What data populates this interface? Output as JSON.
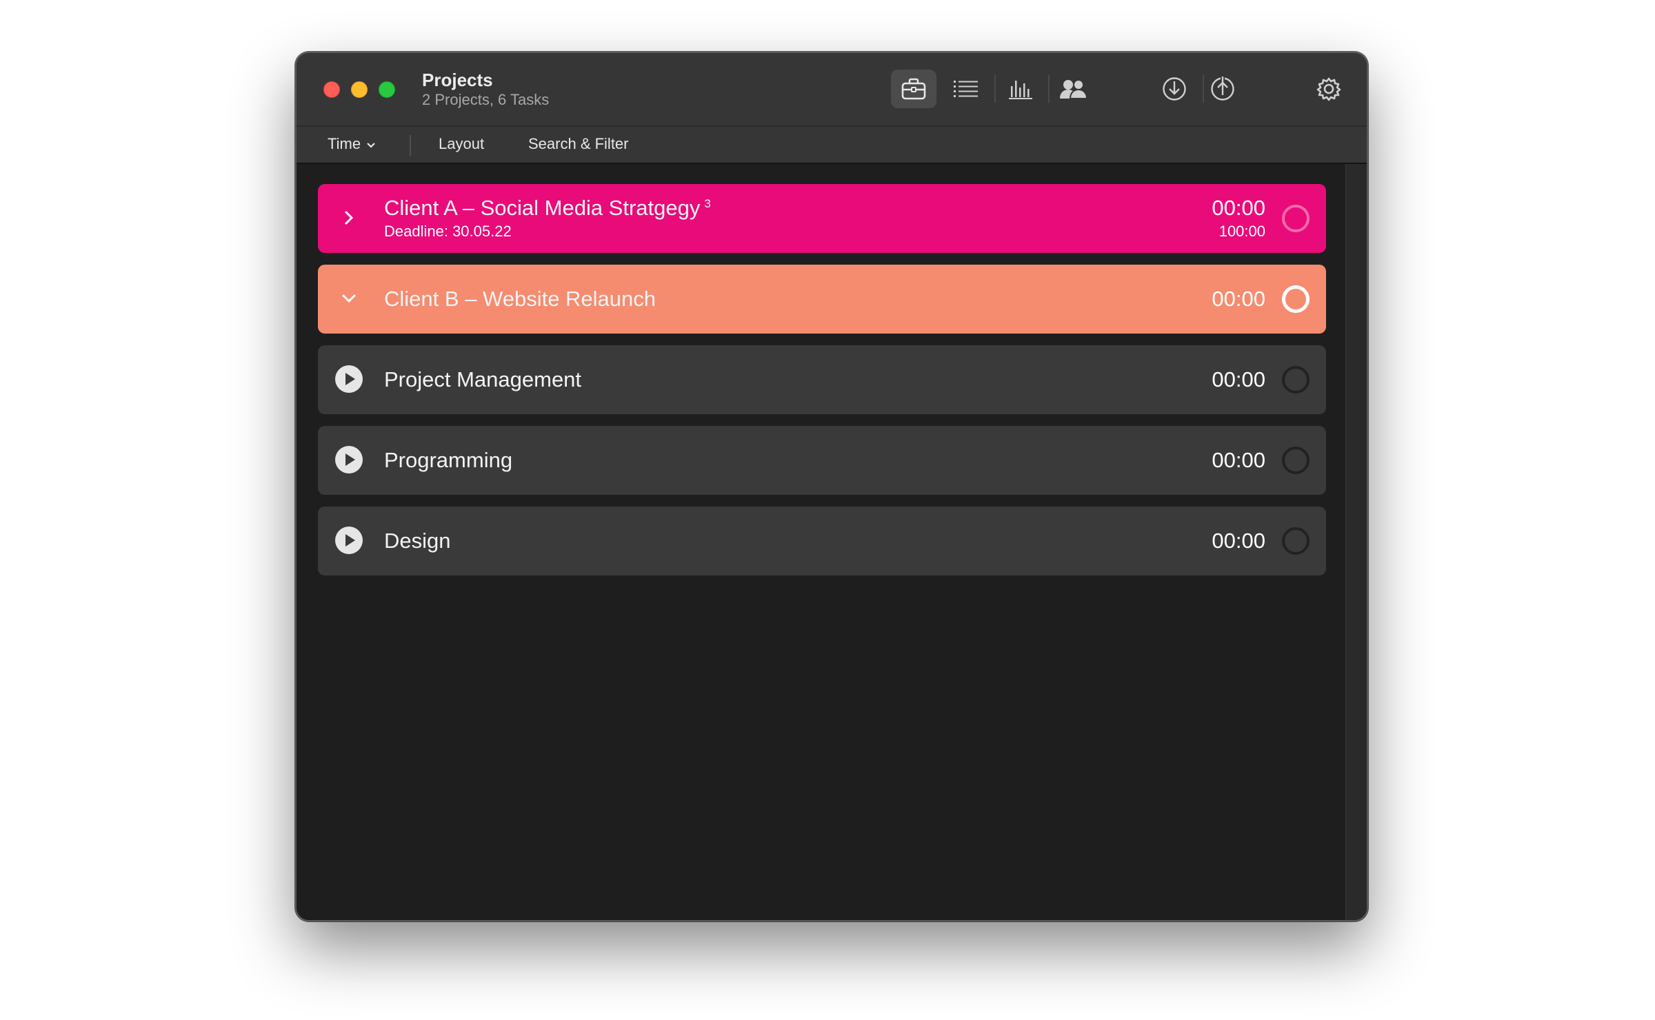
{
  "window": {
    "title": "Projects",
    "subtitle": "2 Projects, 6 Tasks"
  },
  "titlebar_icons": [
    {
      "name": "projects-icon",
      "active": true
    },
    {
      "name": "list-icon",
      "active": false
    },
    {
      "name": "statistics-icon",
      "active": false
    },
    {
      "name": "clients-icon",
      "active": false
    },
    {
      "name": "import-icon",
      "active": false
    },
    {
      "name": "export-icon",
      "active": false
    },
    {
      "name": "settings-gear-icon",
      "active": false
    }
  ],
  "toolbar": {
    "time_label": "Time",
    "layout_label": "Layout",
    "search_filter_label": "Search & Filter"
  },
  "projects": [
    {
      "name": "Client A – Social Media Stratgegy",
      "badge": "3",
      "deadline": "Deadline: 30.05.22",
      "time": "00:00",
      "budget": "100:00",
      "color": "#e80b79",
      "expanded": false
    },
    {
      "name": "Client B – Website Relaunch",
      "time": "00:00",
      "color": "#f58c70",
      "expanded": true
    }
  ],
  "tasks": [
    {
      "name": "Project Management",
      "time": "00:00"
    },
    {
      "name": "Programming",
      "time": "00:00"
    },
    {
      "name": "Design",
      "time": "00:00"
    }
  ],
  "colors": {
    "task_row": "#3a3a3a",
    "content_bg": "#1e1e1e",
    "titlebar_bg": "#363636"
  }
}
